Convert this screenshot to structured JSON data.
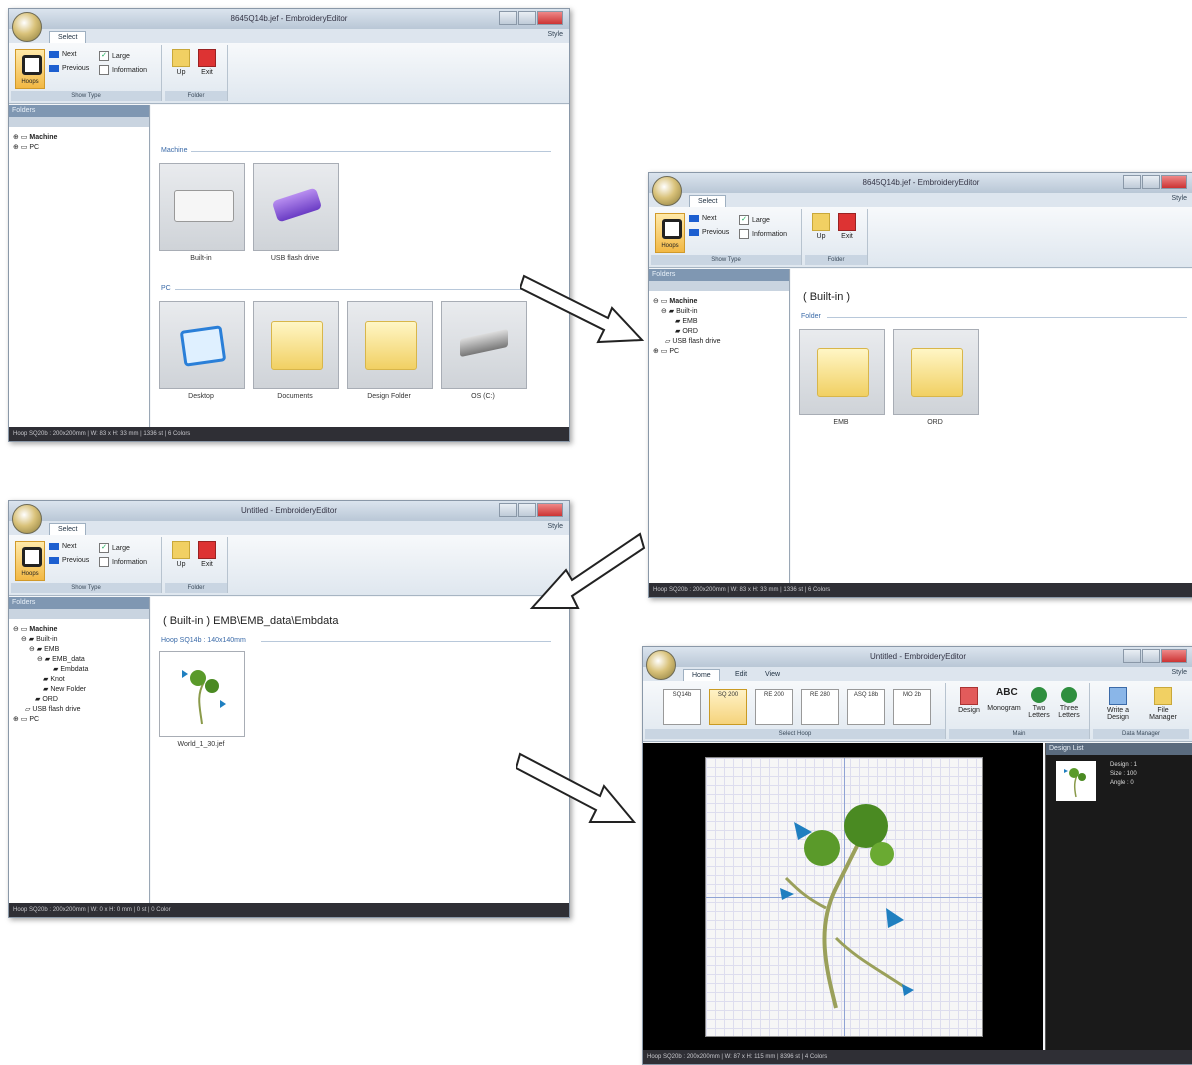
{
  "win1": {
    "title": "8645Q14b.jef - EmbroideryEditor",
    "tab": "Select",
    "style": "Style",
    "hoops_label": "Hoops",
    "next_label": "Next",
    "previous_label": "Previous",
    "large_label": "Large",
    "information_label": "Information",
    "show_type_label": "Show Type",
    "up_label": "Up",
    "exit_label": "Exit",
    "folder_group_label": "Folder",
    "folders_header": "Folders",
    "tree": [
      "Machine",
      "PC"
    ],
    "section_machine": "Machine",
    "section_pc": "PC",
    "tiles_machine": [
      "Built-in",
      "USB flash drive"
    ],
    "tiles_pc": [
      "Desktop",
      "Documents",
      "Design Folder",
      "OS (C:)"
    ],
    "status": "Hoop SQ20b : 200x200mm  |  W: 83 x H: 33 mm  |  1336 st  |  6 Colors"
  },
  "win2": {
    "title": "8645Q14b.jef - EmbroideryEditor",
    "tab": "Select",
    "style": "Style",
    "hoops_label": "Hoops",
    "next_label": "Next",
    "previous_label": "Previous",
    "large_label": "Large",
    "information_label": "Information",
    "show_type_label": "Show Type",
    "up_label": "Up",
    "exit_label": "Exit",
    "folder_group_label": "Folder",
    "folders_header": "Folders",
    "tree": [
      "Machine",
      "Built-in",
      "EMB",
      "ORD",
      "USB flash drive",
      "PC"
    ],
    "path": "( Built-in )",
    "section": "Folder",
    "tiles": [
      "EMB",
      "ORD"
    ],
    "status": "Hoop SQ20b : 200x200mm  |  W: 83 x H: 33 mm  |  1336 st  |  6 Colors"
  },
  "win3": {
    "title": "Untitled - EmbroideryEditor",
    "tab": "Select",
    "style": "Style",
    "hoops_label": "Hoops",
    "next_label": "Next",
    "previous_label": "Previous",
    "large_label": "Large",
    "information_label": "Information",
    "show_type_label": "Show Type",
    "up_label": "Up",
    "exit_label": "Exit",
    "folder_group_label": "Folder",
    "folders_header": "Folders",
    "tree": [
      "Machine",
      "Built-in",
      "EMB",
      "EMB_data",
      "Embdata",
      "Knot",
      "New Folder",
      "ORD",
      "USB flash drive",
      "PC"
    ],
    "path": "( Built-in ) EMB\\EMB_data\\Embdata",
    "section": "Hoop SQ14b : 140x140mm",
    "tile": "World_1_30.jef",
    "status": "Hoop SQ20b : 200x200mm  |  W: 0 x H: 0 mm  |  0 st  |  0 Color"
  },
  "win4": {
    "title": "Untitled - EmbroideryEditor",
    "tabs": [
      "Home",
      "Edit",
      "View"
    ],
    "style": "Style",
    "hoops": [
      "SQ14b",
      "SQ 200",
      "RE 200",
      "RE 280",
      "ASQ 18b",
      "MO 2b"
    ],
    "select_hoop_label": "Select Hoop",
    "tools": [
      "Design",
      "Monogram",
      "Two Letters",
      "Three Letters",
      "Write a Design",
      "File Manager"
    ],
    "main_group": "Main",
    "data_manager_group": "Data Manager",
    "design_list_header": "Design List",
    "design_info": [
      "Design : 1",
      "Size : 100",
      "Angle : 0"
    ],
    "status": "Hoop SQ20b : 200x200mm  |  W: 87 x H: 115 mm  |  8396 st  |  4 Colors"
  },
  "colors": {
    "accent": "#1d5fd0",
    "folder": "#f1d063",
    "status_bg": "#2f2f35",
    "embroidery_green": "#5a9a2a",
    "embroidery_blue": "#1f7fc0"
  }
}
